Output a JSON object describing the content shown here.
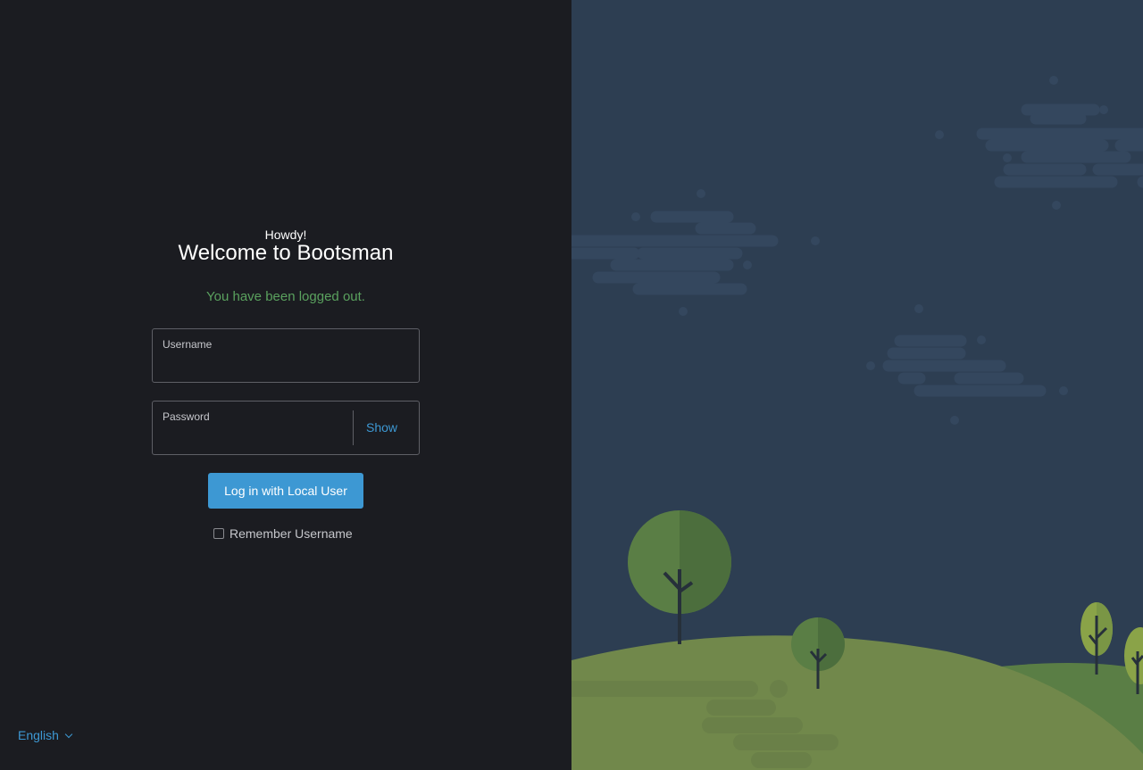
{
  "login": {
    "greeting": "Howdy!",
    "title": "Welcome to Bootsman",
    "status_message": "You have been logged out.",
    "username_label": "Username",
    "username_value": "",
    "password_label": "Password",
    "password_value": "",
    "show_label": "Show",
    "submit_label": "Log in with Local User",
    "remember_label": "Remember Username",
    "remember_checked": false
  },
  "language": {
    "selected": "English"
  },
  "colors": {
    "left_background": "#1b1c21",
    "right_background": "#2d3e52",
    "accent": "#3d98d3",
    "success": "#5aa15e",
    "hill_light": "#71884b",
    "hill_dark": "#5a7e45"
  }
}
